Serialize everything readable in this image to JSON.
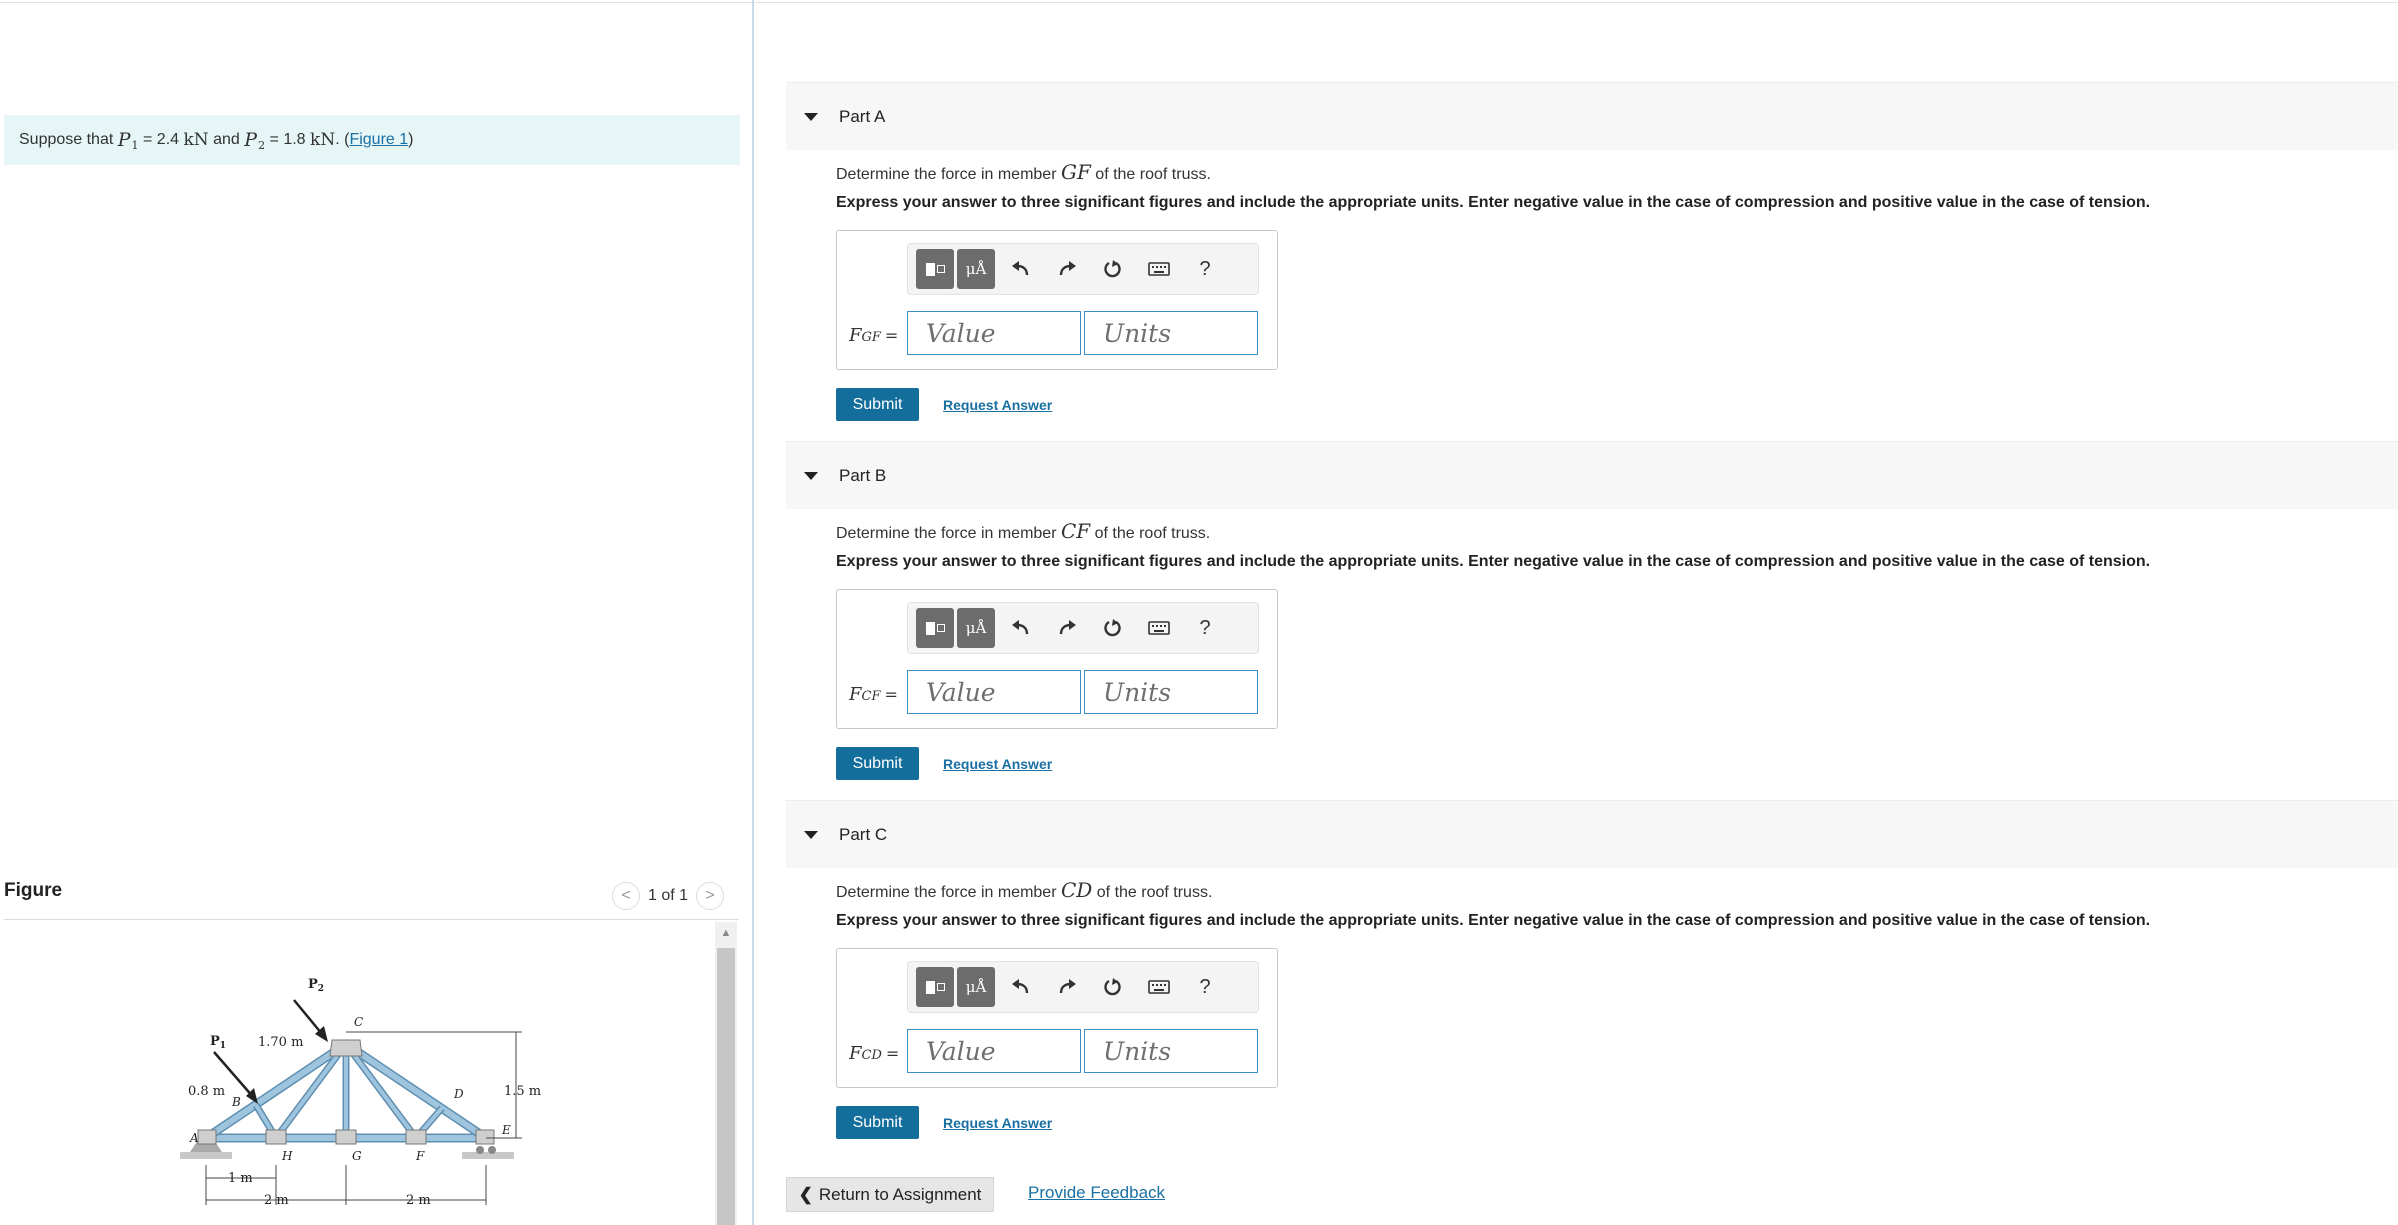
{
  "problem": {
    "intro": "Suppose that",
    "p1_symbol": "P",
    "p1_sub": "1",
    "p1_value": "= 2.4",
    "unit_kn": "kN",
    "and": "and",
    "p2_symbol": "P",
    "p2_sub": "2",
    "p2_value": "= 1.8",
    "unit_kn2": "kN",
    "period": ".",
    "figure_link": "Figure 1",
    "paren_open": "(",
    "paren_close": ")"
  },
  "figure": {
    "title": "Figure",
    "pager": "1 of 1",
    "prev": "<",
    "next": ">",
    "scroll_up": "▲",
    "labels": {
      "P1": "P",
      "P1_sub": "1",
      "P2": "P",
      "P2_sub": "2",
      "d170": "1.70 m",
      "d08": "0.8 m",
      "d15": "1.5 m",
      "d1": "1 m",
      "d2a": "2 m",
      "d2b": "2 m",
      "A": "A",
      "B": "B",
      "C": "C",
      "D": "D",
      "E": "E",
      "F": "F",
      "G": "G",
      "H": "H"
    }
  },
  "parts": [
    {
      "title": "Part A",
      "question_pre": "Determine the force in member",
      "member": "GF",
      "question_post": "of the roof truss.",
      "instructions": "Express your answer to three significant figures and include the appropriate units. Enter negative value in the case of compression and positive value in the case of tension.",
      "label_main": "F",
      "label_sub": "GF",
      "equals": "=",
      "value_placeholder": "Value",
      "units_placeholder": "Units",
      "submit": "Submit",
      "request": "Request Answer"
    },
    {
      "title": "Part B",
      "question_pre": "Determine the force in member",
      "member": "CF",
      "question_post": "of the roof truss.",
      "instructions": "Express your answer to three significant figures and include the appropriate units. Enter negative value in the case of compression and positive value in the case of tension.",
      "label_main": "F",
      "label_sub": "CF",
      "equals": "=",
      "value_placeholder": "Value",
      "units_placeholder": "Units",
      "submit": "Submit",
      "request": "Request Answer"
    },
    {
      "title": "Part C",
      "question_pre": "Determine the force in member",
      "member": "CD",
      "question_post": "of the roof truss.",
      "instructions": "Express your answer to three significant figures and include the appropriate units. Enter negative value in the case of compression and positive value in the case of tension.",
      "label_main": "F",
      "label_sub": "CD",
      "equals": "=",
      "value_placeholder": "Value",
      "units_placeholder": "Units",
      "submit": "Submit",
      "request": "Request Answer"
    }
  ],
  "toolbar": {
    "units_glyph": "μÅ",
    "help": "?"
  },
  "footer": {
    "return_chevron": "❮",
    "return_label": "Return to Assignment",
    "feedback_label": "Provide Feedback"
  },
  "colors": {
    "accent": "#146e9c",
    "link": "#1a6fa3",
    "problem_bg": "#e6f5f6",
    "input_border": "#3b8fc4",
    "truss_member": "#9ec4de"
  }
}
